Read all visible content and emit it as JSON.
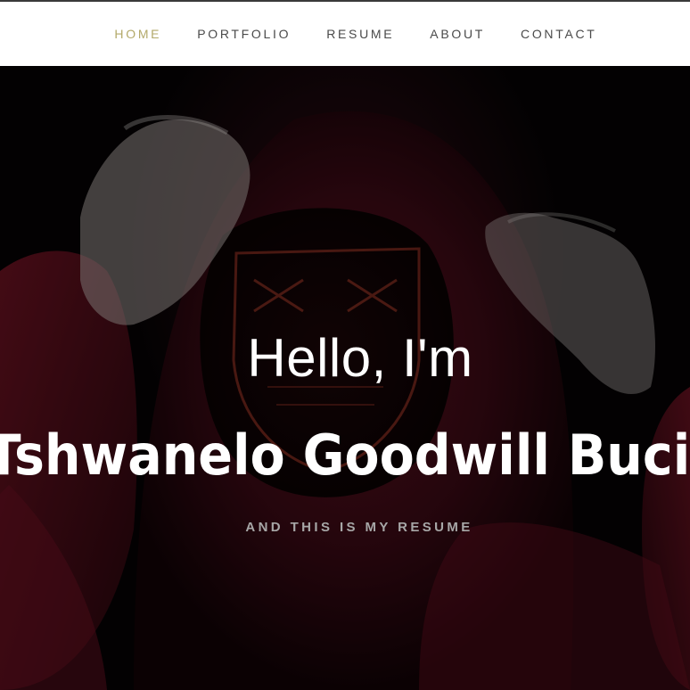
{
  "nav": {
    "items": [
      {
        "label": "HOME",
        "active": true
      },
      {
        "label": "PORTFOLIO",
        "active": false
      },
      {
        "label": "RESUME",
        "active": false
      },
      {
        "label": "ABOUT",
        "active": false
      },
      {
        "label": "CONTACT",
        "active": false
      }
    ],
    "active_color": "#b3a96a",
    "text_color": "#4a4a4a"
  },
  "hero": {
    "greeting": "Hello, I'm",
    "name": "Tshwanelo Goodwill Buciko",
    "tagline": "AND THIS IS MY RESUME",
    "accent_color": "#8b1a2e"
  }
}
